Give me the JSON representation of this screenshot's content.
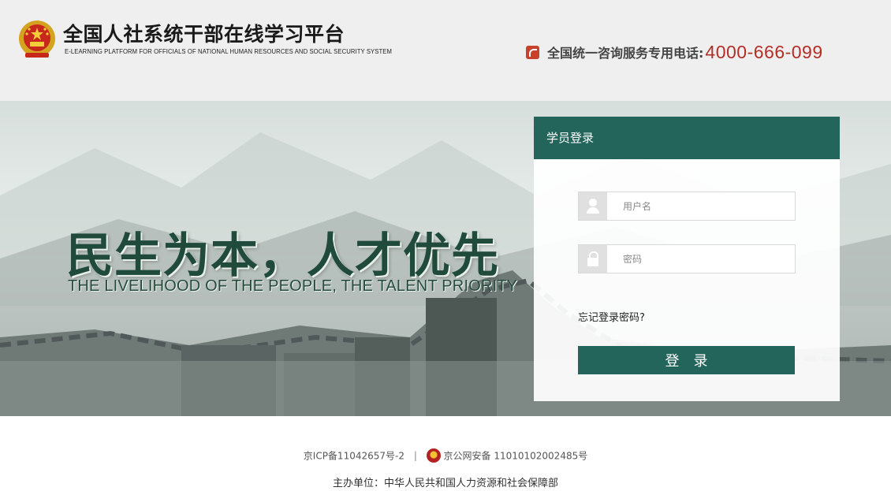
{
  "header": {
    "title": "全国人社系统干部在线学习平台",
    "subtitle": "E-LEARNING PLATFORM FOR OFFICIALS OF NATIONAL HUMAN RESOURCES AND SOCIAL SECURITY SYSTEM",
    "hotline_label": "全国统一咨询服务专用电话:",
    "hotline_number": "4000-666-099"
  },
  "banner": {
    "slogan_cn": "民生为本，人才优先",
    "slogan_en": "THE LIVELIHOOD OF THE PEOPLE, THE TALENT PRIORITY"
  },
  "login": {
    "title": "学员登录",
    "username_placeholder": "用户名",
    "password_placeholder": "密码",
    "forgot_label": "忘记登录密码?",
    "submit_label": "登录"
  },
  "footer": {
    "icp": "京ICP备11042657号-2",
    "separator": "|",
    "police": "京公网安备 11010102002485号",
    "sponsor": "主办单位：中华人民共和国人力资源和社会保障部"
  },
  "colors": {
    "brand_green": "#24655b",
    "hotline_red": "#b32e27",
    "header_bg": "#efefef"
  },
  "icons": [
    "national-emblem-icon",
    "phone-icon",
    "user-icon",
    "lock-icon",
    "police-badge-icon"
  ]
}
